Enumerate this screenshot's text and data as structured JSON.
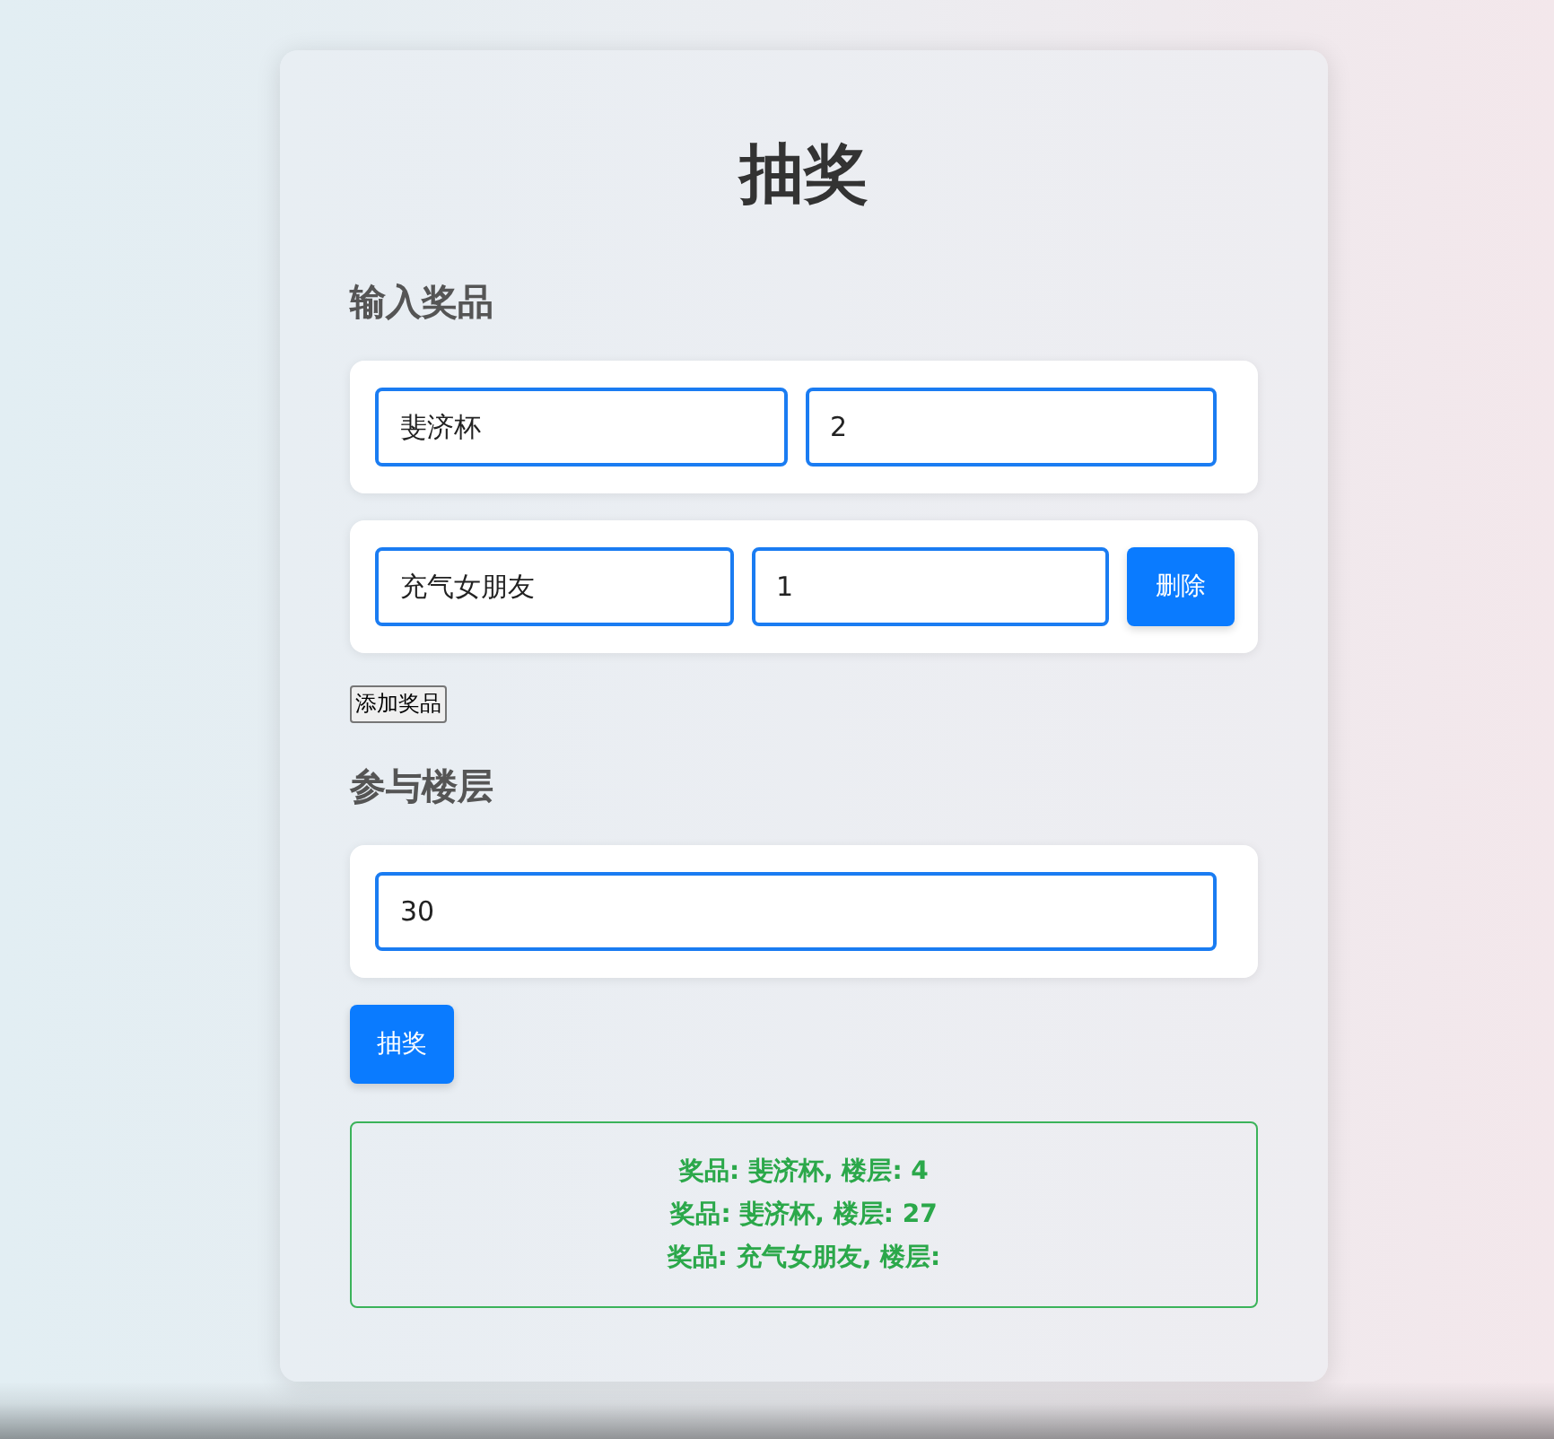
{
  "title": "抽奖",
  "prize_section": {
    "heading": "输入奖品",
    "prizes": [
      {
        "name": "斐济杯",
        "count": "2"
      },
      {
        "name": "充气女朋友",
        "count": "1",
        "remove_button": "删除"
      }
    ],
    "add_button": "添加奖品"
  },
  "floor_section": {
    "heading": "参与楼层",
    "floor_count": "30"
  },
  "draw_button": "抽奖",
  "results": [
    "奖品: 斐济杯, 楼层: 4",
    "奖品: 斐济杯, 楼层: 27",
    "奖品: 充气女朋友, 楼层:"
  ]
}
